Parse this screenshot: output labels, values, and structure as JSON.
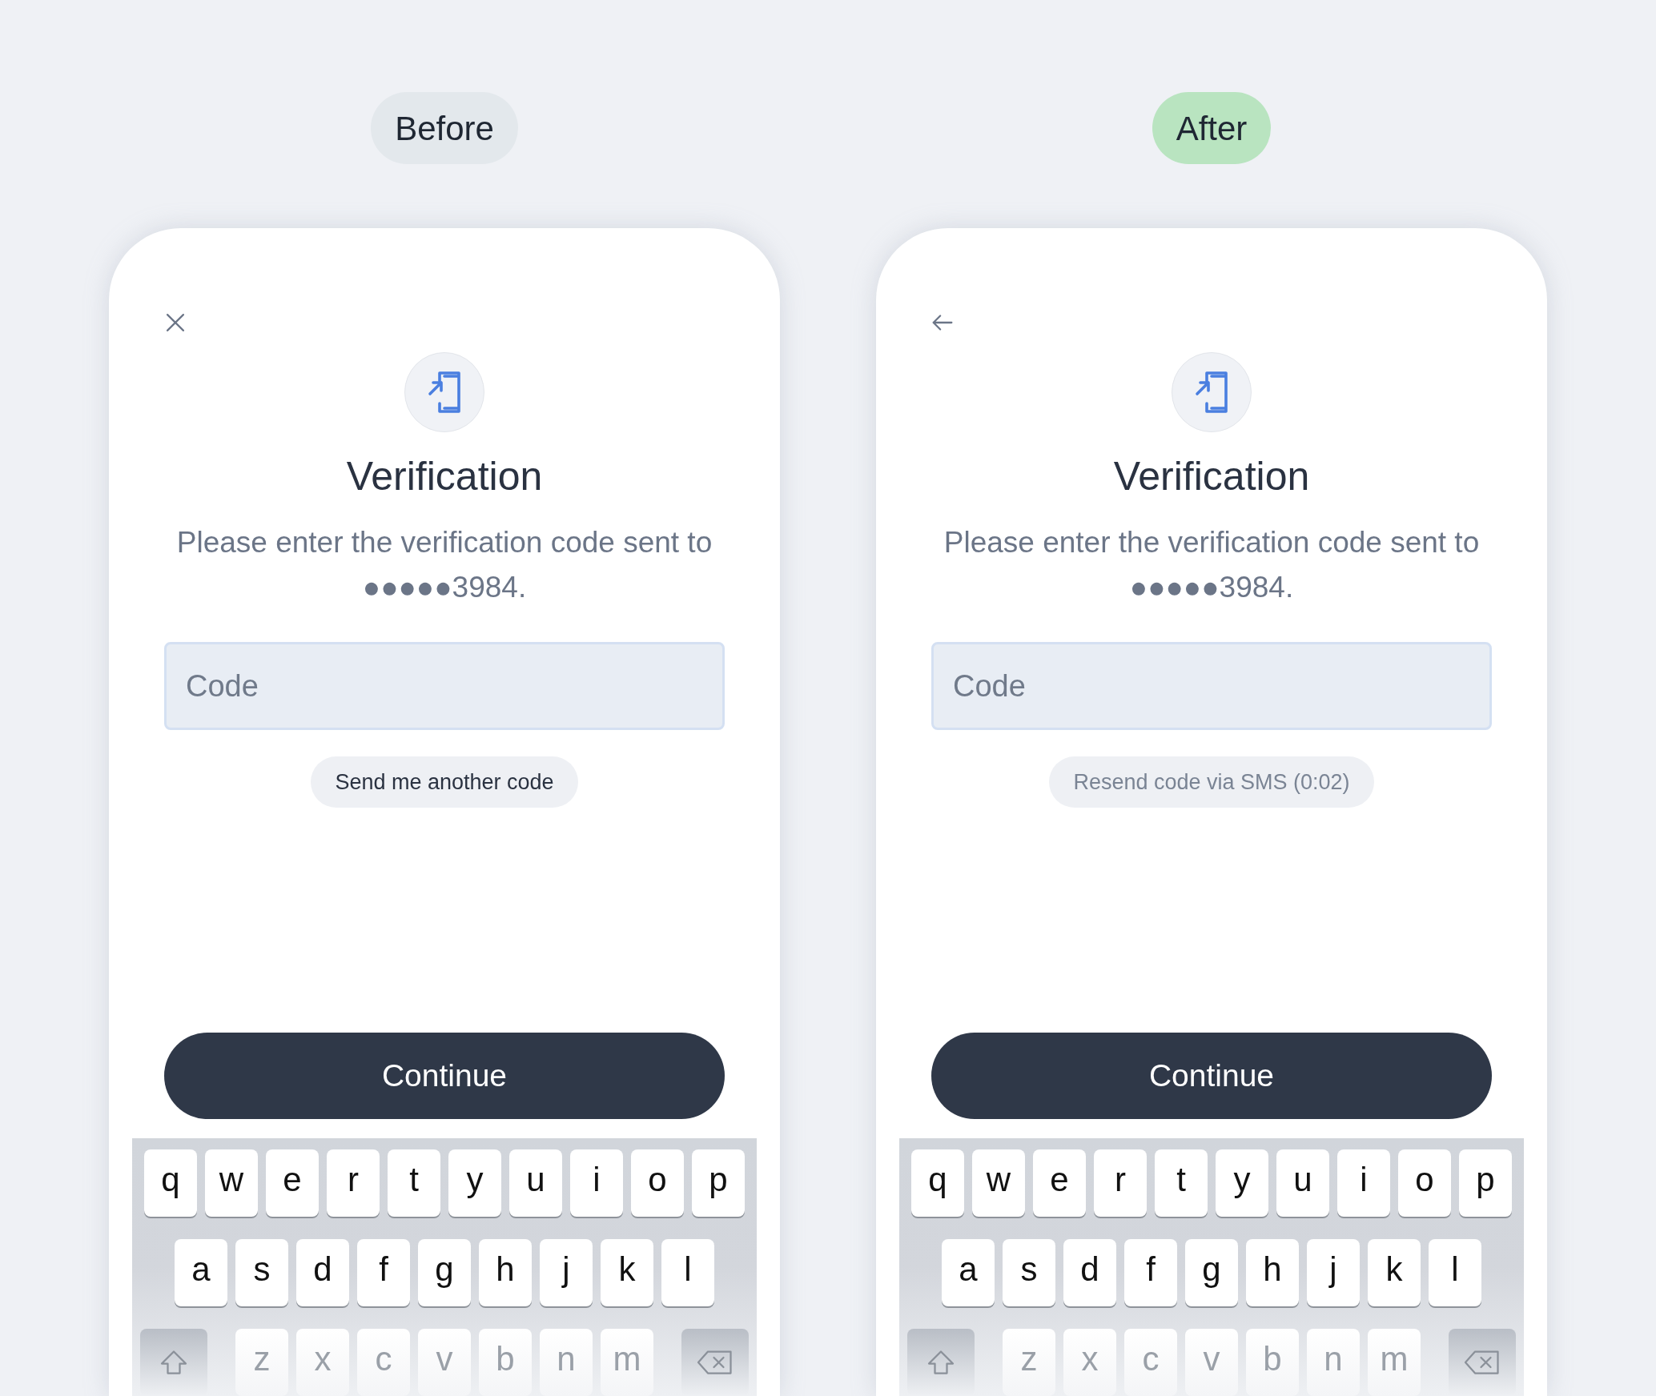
{
  "panels": [
    {
      "label": "Before",
      "color": "#e3e8ec",
      "nav": {
        "kind": "close"
      },
      "title": "Verification",
      "message": "Please enter the verification code sent to ●●●●●3984.",
      "code_field": {
        "placeholder": "Code"
      },
      "resend": {
        "text": "Send me another code",
        "disabled": false
      },
      "button": "Continue",
      "keyboard": {
        "rows": [
          [
            "q",
            "w",
            "e",
            "r",
            "t",
            "y",
            "u",
            "i",
            "o",
            "p"
          ],
          [
            "a",
            "s",
            "d",
            "f",
            "g",
            "h",
            "j",
            "k",
            "l"
          ],
          [
            "z",
            "x",
            "c",
            "v",
            "b",
            "n",
            "m"
          ]
        ]
      }
    },
    {
      "label": "After",
      "color": "#b9e4c0",
      "nav": {
        "kind": "back"
      },
      "title": "Verification",
      "message": "Please enter the verification code sent to ●●●●●3984.",
      "code_field": {
        "placeholder": "Code"
      },
      "resend": {
        "text": "Resend code via SMS (0:02)",
        "disabled": true
      },
      "button": "Continue",
      "keyboard": {
        "rows": [
          [
            "q",
            "w",
            "e",
            "r",
            "t",
            "y",
            "u",
            "i",
            "o",
            "p"
          ],
          [
            "a",
            "s",
            "d",
            "f",
            "g",
            "h",
            "j",
            "k",
            "l"
          ],
          [
            "z",
            "x",
            "c",
            "v",
            "b",
            "n",
            "m"
          ]
        ]
      }
    }
  ]
}
